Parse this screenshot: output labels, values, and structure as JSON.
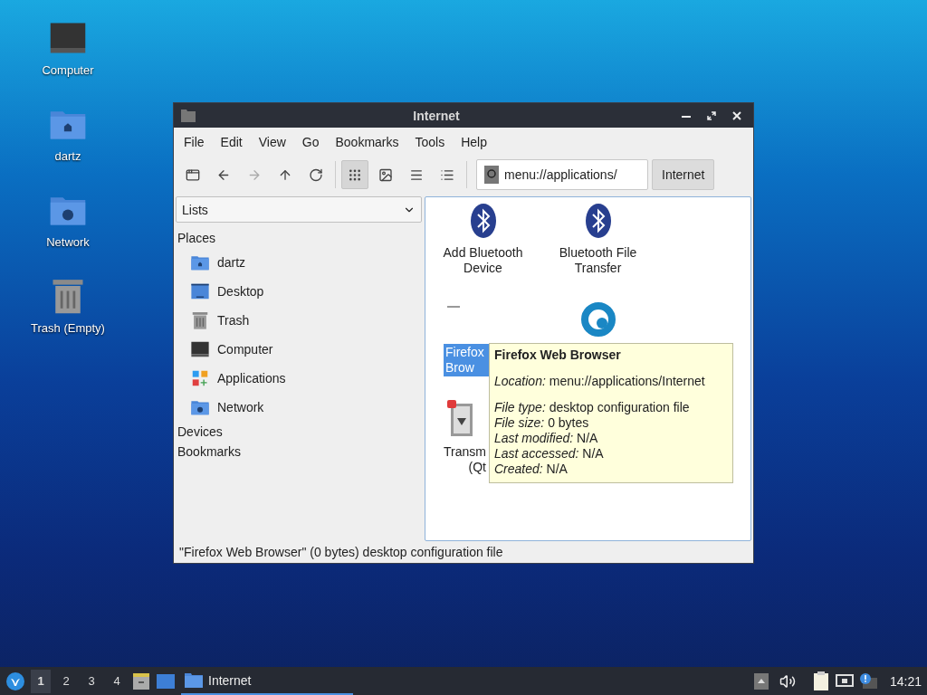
{
  "desktop_icons": [
    {
      "kind": "computer",
      "label": "Computer"
    },
    {
      "kind": "home",
      "label": "dartz"
    },
    {
      "kind": "network",
      "label": "Network"
    },
    {
      "kind": "trash",
      "label": "Trash (Empty)"
    }
  ],
  "window": {
    "title": "Internet",
    "menu": [
      "File",
      "Edit",
      "View",
      "Go",
      "Bookmarks",
      "Tools",
      "Help"
    ],
    "toolbar": [
      {
        "kind": "new-tab",
        "disabled": false
      },
      {
        "kind": "back",
        "disabled": false
      },
      {
        "kind": "forward",
        "disabled": true
      },
      {
        "kind": "up",
        "disabled": false
      },
      {
        "kind": "reload",
        "disabled": false
      }
    ],
    "view_modes": [
      {
        "kind": "icons",
        "selected": true
      },
      {
        "kind": "thumbnails",
        "selected": false
      },
      {
        "kind": "compact",
        "selected": false
      },
      {
        "kind": "details",
        "selected": false
      }
    ],
    "address": {
      "value": "menu://applications/"
    },
    "path_buttons": [
      "Internet"
    ],
    "side_panel": {
      "mode": "Lists",
      "sections": [
        {
          "title": "Places",
          "items": [
            {
              "kind": "home",
              "label": "dartz"
            },
            {
              "kind": "desktop",
              "label": "Desktop"
            },
            {
              "kind": "trash",
              "label": "Trash"
            },
            {
              "kind": "computer",
              "label": "Computer"
            },
            {
              "kind": "applications",
              "label": "Applications"
            },
            {
              "kind": "network",
              "label": "Network"
            }
          ]
        },
        {
          "title": "Devices"
        },
        {
          "title": "Bookmarks"
        }
      ]
    },
    "files": [
      {
        "kind": "bluetooth",
        "lines": [
          "Add Bluetooth",
          "Device"
        ],
        "selected": false
      },
      {
        "kind": "bluetooth",
        "lines": [
          "Bluetooth File",
          "Transfer"
        ],
        "selected": false
      },
      {
        "kind": "broken",
        "lines": [
          "Firefox",
          "Brow"
        ],
        "selected": true
      },
      {
        "kind": "swirl",
        "selected": false
      },
      {
        "kind": "transmission",
        "lines": [
          "Transm",
          "(Qt"
        ],
        "selected": false
      }
    ],
    "tooltip": {
      "title": "Firefox Web Browser",
      "groups": [
        [
          {
            "key": "Location:",
            "value": "menu://applications/Internet"
          }
        ],
        [
          {
            "key": "File type:",
            "value": "desktop configuration file"
          },
          {
            "key": "File size:",
            "value": "0 bytes"
          },
          {
            "key": "Last modified:",
            "value": "N/A"
          },
          {
            "key": "Last accessed:",
            "value": "N/A"
          },
          {
            "key": "Created:",
            "value": "N/A"
          }
        ]
      ]
    },
    "status_bar": "\"Firefox Web Browser\" (0 bytes) desktop configuration file"
  },
  "taskbar": {
    "workspaces": [
      {
        "label": "1",
        "selected": true
      },
      {
        "label": "2",
        "selected": false
      },
      {
        "label": "3",
        "selected": false
      },
      {
        "label": "4",
        "selected": false
      }
    ],
    "tasks": [
      {
        "label": "Internet",
        "selected": true
      }
    ],
    "clock": "14:21"
  }
}
